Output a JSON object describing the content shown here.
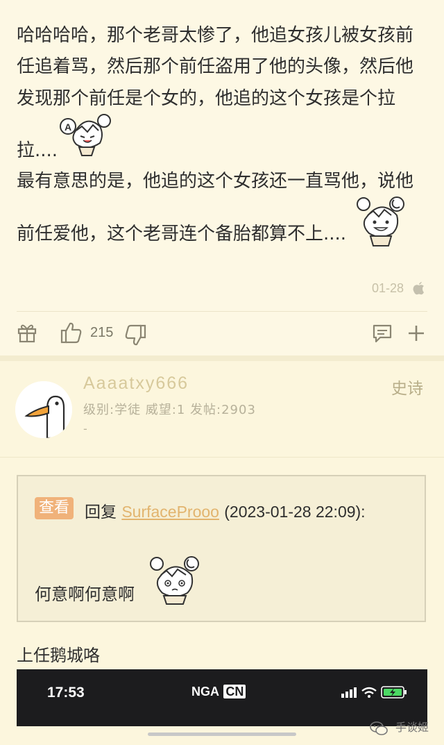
{
  "post1": {
    "lines": [
      "哈哈哈哈，那个老哥太惨了，他追女孩儿被女孩前",
      "任追着骂，然后那个前任盗用了他的头像，然后他",
      "发现那个前任是个女的，他追的这个女孩是个拉",
      "拉....",
      "最有意思的是，他追的这个女孩还一直骂他，说他",
      "前任爱他，这个老哥连个备胎都算不上...."
    ],
    "date": "01-28",
    "like_count": "215",
    "stickers": [
      "sticker-girl-laughing",
      "sticker-girl-grinning"
    ]
  },
  "post2": {
    "username": "Aaaatxy666",
    "user_stats": "级别:学徒 威望:1 发帖:2903",
    "user_dash": "-",
    "rank": "史诗",
    "quote": {
      "view_badge": "查看",
      "reply_prefix": "回复",
      "reply_user": "SurfaceProoo",
      "reply_date": "(2023-01-28 22:09):",
      "text": "何意啊何意啊"
    },
    "body_text": "上任鹅城咯",
    "screenshot": {
      "time": "17:53",
      "logo": "NGA",
      "logo_badge": "CN"
    }
  },
  "watermark": {
    "label": "手谈姬"
  },
  "colors": {
    "page_bg": "#fdf8e4",
    "badge": "#f0b27a",
    "username": "#d7c99b",
    "link": "#e2b46e"
  },
  "icons": [
    "gift-icon",
    "thumbs-up-icon",
    "thumbs-down-icon",
    "comment-icon",
    "plus-icon",
    "apple-icon",
    "goose-avatar",
    "wechat-icon"
  ]
}
